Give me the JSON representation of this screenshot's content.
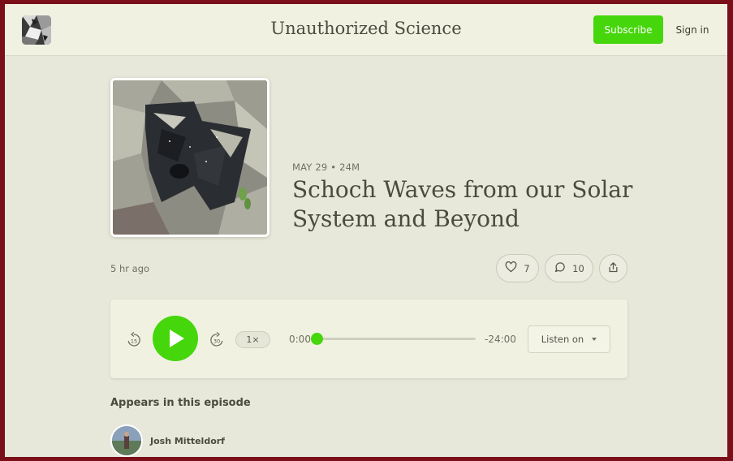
{
  "header": {
    "site_title": "Unauthorized Science",
    "subscribe_label": "Subscribe",
    "signin_label": "Sign in",
    "logo_icon": "publication-logo-icon"
  },
  "episode": {
    "date": "MAY 29",
    "separator": "•",
    "duration": "24M",
    "title": "Schoch Waves from our Solar System and Beyond",
    "posted": "5 hr ago",
    "likes": "7",
    "comments": "10"
  },
  "player": {
    "rewind_seconds": "15",
    "forward_seconds": "30",
    "speed": "1×",
    "elapsed": "0:00",
    "remaining": "-24:00",
    "progress": 0,
    "listen_on_label": "Listen on"
  },
  "appears": {
    "heading": "Appears in this episode",
    "people": [
      {
        "name": "Josh Mitteldorf"
      }
    ]
  },
  "colors": {
    "accent": "#45d60b",
    "background": "#e8e8da",
    "header_bg": "#f1f1e2",
    "frame": "#7a0f1a",
    "text": "#4a4a3e"
  }
}
